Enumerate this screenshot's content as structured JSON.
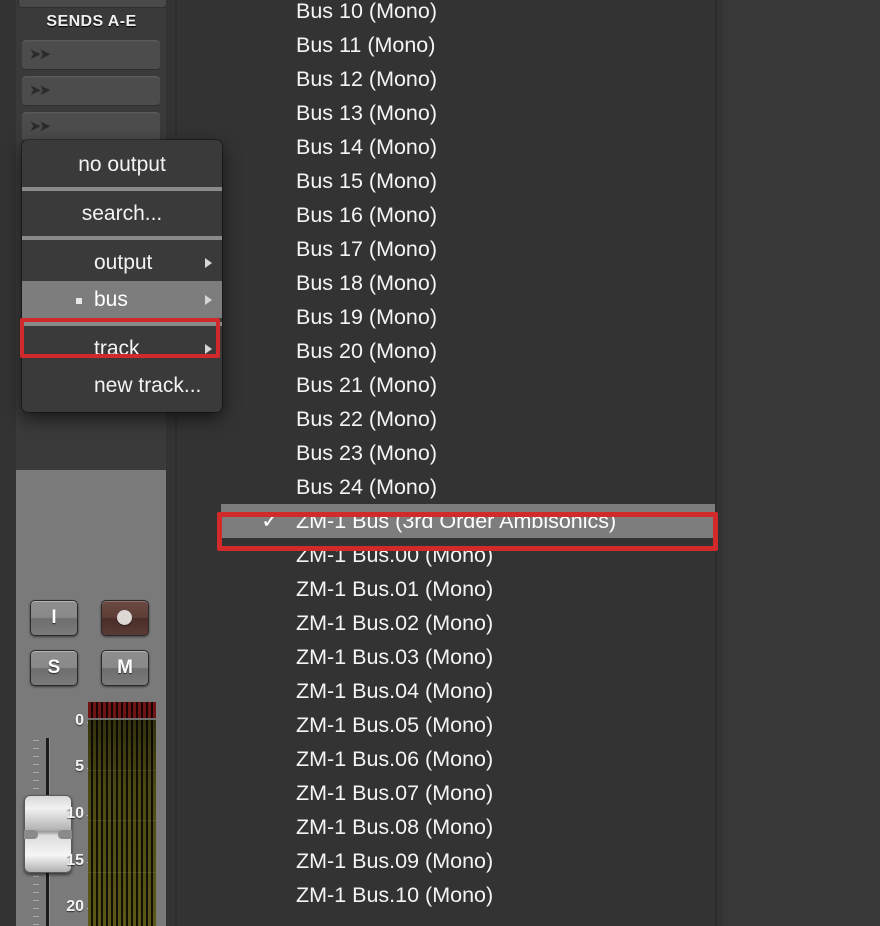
{
  "mixer_strip": {
    "sends_header": "SENDS A-E",
    "send_slots": [
      {
        "icon": "double-arrow-icon",
        "label": ""
      },
      {
        "icon": "double-arrow-icon",
        "label": ""
      },
      {
        "icon": "double-arrow-icon",
        "label": ""
      }
    ],
    "buttons": {
      "input": "I",
      "record": "",
      "solo": "S",
      "mute": "M"
    },
    "fader": {
      "scale_labels": [
        "0",
        "5",
        "10",
        "15",
        "20"
      ]
    },
    "meter": {
      "clip_color": "#6e1414",
      "level_color": "#5d5a18"
    }
  },
  "context_menu": {
    "items": [
      {
        "label": "no output",
        "type": "plain",
        "centered": true,
        "marker": "",
        "submenu": false
      },
      {
        "label": "search...",
        "type": "plain",
        "centered": true,
        "marker": "",
        "submenu": false
      },
      {
        "label": "output",
        "type": "plain",
        "centered": false,
        "marker": "",
        "submenu": true
      },
      {
        "label": "bus",
        "type": "highlighted",
        "centered": false,
        "marker": "bullet-marker",
        "submenu": true
      },
      {
        "label": "track",
        "type": "plain",
        "centered": false,
        "marker": "",
        "submenu": true
      },
      {
        "label": "new track...",
        "type": "plain",
        "centered": false,
        "marker": "",
        "submenu": false
      }
    ]
  },
  "submenu": {
    "items": [
      {
        "label": "Bus 10 (Mono)",
        "checked": false
      },
      {
        "label": "Bus 11 (Mono)",
        "checked": false
      },
      {
        "label": "Bus 12 (Mono)",
        "checked": false
      },
      {
        "label": "Bus 13 (Mono)",
        "checked": false
      },
      {
        "label": "Bus 14 (Mono)",
        "checked": false
      },
      {
        "label": "Bus 15 (Mono)",
        "checked": false
      },
      {
        "label": "Bus 16 (Mono)",
        "checked": false
      },
      {
        "label": "Bus 17 (Mono)",
        "checked": false
      },
      {
        "label": "Bus 18 (Mono)",
        "checked": false
      },
      {
        "label": "Bus 19 (Mono)",
        "checked": false
      },
      {
        "label": "Bus 20 (Mono)",
        "checked": false
      },
      {
        "label": "Bus 21 (Mono)",
        "checked": false
      },
      {
        "label": "Bus 22 (Mono)",
        "checked": false
      },
      {
        "label": "Bus 23 (Mono)",
        "checked": false
      },
      {
        "label": "Bus 24 (Mono)",
        "checked": false
      },
      {
        "label": "ZM-1 Bus (3rd Order Ambisonics)",
        "checked": true
      },
      {
        "label": "ZM-1 Bus.00 (Mono)",
        "checked": false
      },
      {
        "label": "ZM-1 Bus.01 (Mono)",
        "checked": false
      },
      {
        "label": "ZM-1 Bus.02 (Mono)",
        "checked": false
      },
      {
        "label": "ZM-1 Bus.03 (Mono)",
        "checked": false
      },
      {
        "label": "ZM-1 Bus.04 (Mono)",
        "checked": false
      },
      {
        "label": "ZM-1 Bus.05 (Mono)",
        "checked": false
      },
      {
        "label": "ZM-1 Bus.06 (Mono)",
        "checked": false
      },
      {
        "label": "ZM-1 Bus.07 (Mono)",
        "checked": false
      },
      {
        "label": "ZM-1 Bus.08 (Mono)",
        "checked": false
      },
      {
        "label": "ZM-1 Bus.09 (Mono)",
        "checked": false
      },
      {
        "label": "ZM-1 Bus.10 (Mono)",
        "checked": false
      }
    ],
    "check_glyph": "✓"
  },
  "annotations": {
    "highlight_color": "#d2292a",
    "boxes": [
      "bus-menu-item",
      "zm-1-bus-selected-item"
    ]
  }
}
